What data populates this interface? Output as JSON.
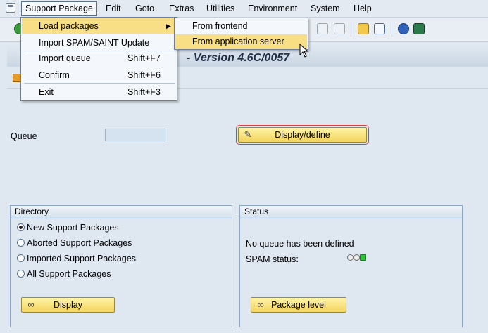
{
  "menubar": {
    "items": [
      "Support Package",
      "Edit",
      "Goto",
      "Extras",
      "Utilities",
      "Environment",
      "System",
      "Help"
    ]
  },
  "title": {
    "text": "- Version 4.6C/0057"
  },
  "queue": {
    "label": "Queue",
    "value": "",
    "button": "Display/define"
  },
  "directory": {
    "title": "Directory",
    "options": [
      "New Support Packages",
      "Aborted Support Packages",
      "Imported Support Packages",
      "All Support Packages"
    ],
    "selected": "New Support Packages",
    "button": "Display"
  },
  "status": {
    "title": "Status",
    "message": "No queue has been defined",
    "spam_label": "SPAM status:",
    "button": "Package level",
    "lights": [
      "off",
      "off",
      "green"
    ]
  },
  "dropdown": {
    "items": [
      {
        "label": "Load packages",
        "shortcut": "",
        "has_submenu": true
      },
      {
        "label": "Import SPAM/SAINT Update",
        "shortcut": ""
      },
      {
        "label": "Import queue",
        "shortcut": "Shift+F7"
      },
      {
        "label": "Confirm",
        "shortcut": "Shift+F6"
      },
      {
        "label": "Exit",
        "shortcut": "Shift+F3"
      }
    ]
  },
  "submenu": {
    "items": [
      "From frontend",
      "From application server"
    ]
  },
  "colors": {
    "highlight": "#f8df86",
    "button": "#f2d35a",
    "background": "#dfe8f1"
  }
}
